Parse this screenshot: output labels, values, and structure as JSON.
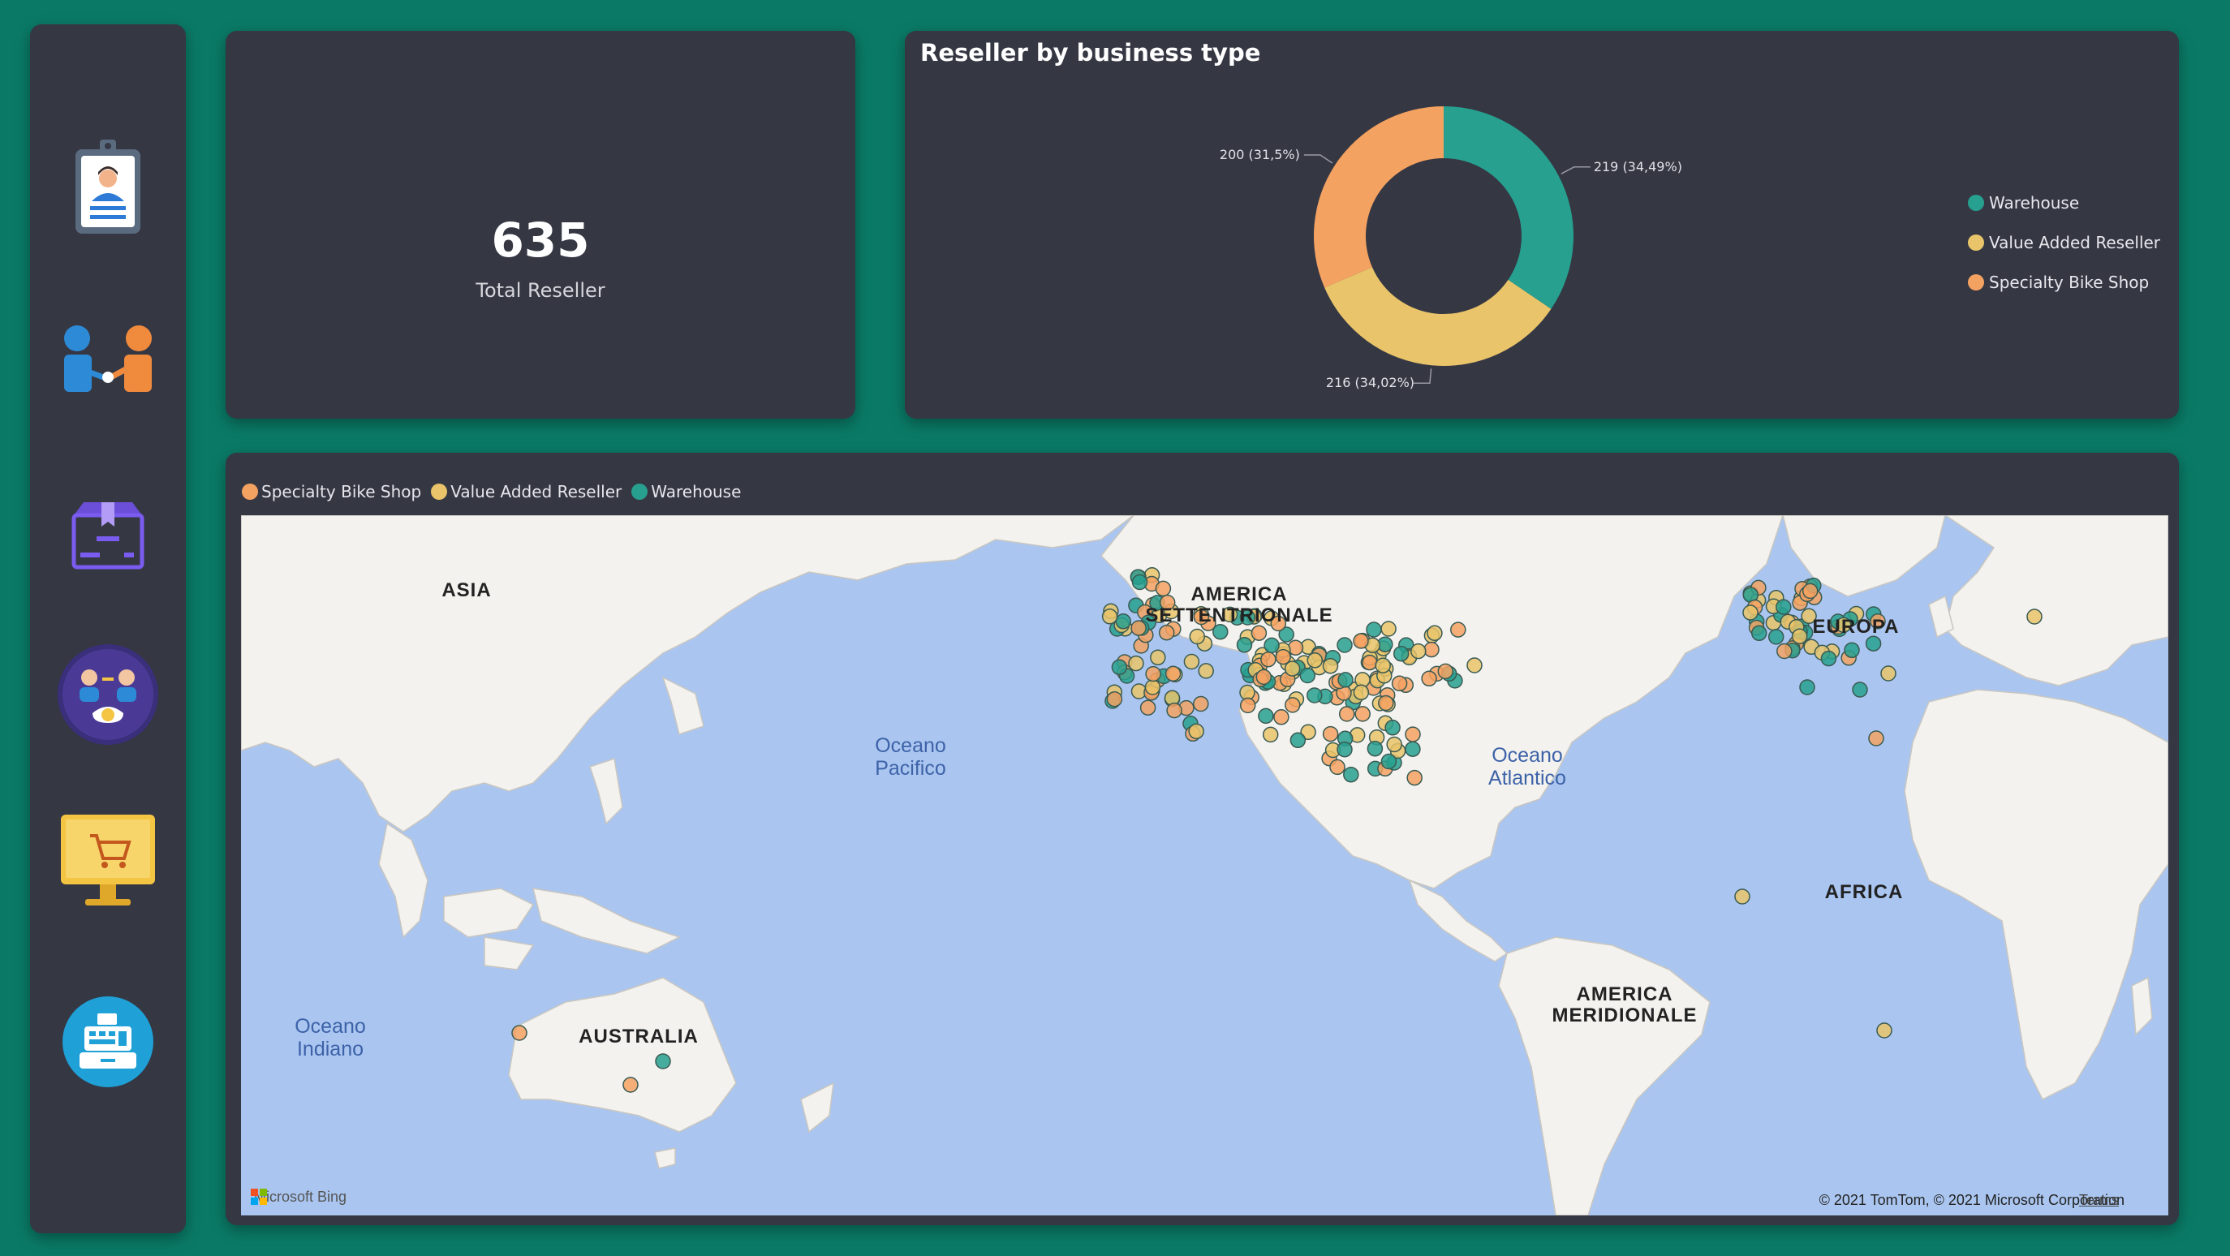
{
  "sidebar": {
    "items": [
      {
        "name": "employee-badge"
      },
      {
        "name": "reseller-handshake"
      },
      {
        "name": "product-box"
      },
      {
        "name": "sales-team"
      },
      {
        "name": "online-shop"
      },
      {
        "name": "cash-register"
      }
    ]
  },
  "kpi": {
    "value": "635",
    "label": "Total Reseller"
  },
  "donut": {
    "title": "Reseller by business type",
    "segments": [
      {
        "name": "Warehouse",
        "value": 219,
        "label": "219 (34,49%)",
        "color": "#27a08f"
      },
      {
        "name": "Value Added Reseller",
        "value": 216,
        "label": "216 (34,02%)",
        "color": "#e9c46a"
      },
      {
        "name": "Specialty Bike Shop",
        "value": 200,
        "label": "200 (31,5%)",
        "color": "#f4a261"
      }
    ],
    "legend": [
      "Warehouse",
      "Value Added Reseller",
      "Specialty Bike Shop"
    ]
  },
  "map": {
    "legend": [
      "Specialty Bike Shop",
      "Value Added Reseller",
      "Warehouse"
    ],
    "continents": {
      "asia": "ASIA",
      "north_america_1": "AMERICA",
      "north_america_2": "SETTENTRIONALE",
      "europe": "EUROPA",
      "africa": "AFRICA",
      "south_america_1": "AMERICA",
      "south_america_2": "MERIDIONALE",
      "australia": "AUSTRALIA"
    },
    "oceans": {
      "pacific_1": "Oceano",
      "pacific_2": "Pacifico",
      "atlantic_1": "Oceano",
      "atlantic_2": "Atlantico",
      "indian_1": "Oceano",
      "indian_2": "Indiano"
    },
    "bing_logo": "Microsoft Bing",
    "copyright": "© 2021 TomTom, © 2021 Microsoft Corporation",
    "terms": "Terms"
  }
}
